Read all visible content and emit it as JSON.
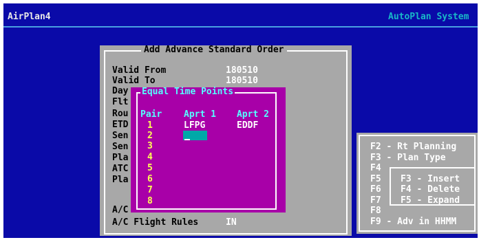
{
  "header": {
    "app_title": "AirPlan4",
    "system_title": "AutoPlan System"
  },
  "order": {
    "title": "Add Advance Standard Order",
    "fields": [
      {
        "label": "Valid From",
        "value": "180510"
      },
      {
        "label": "Valid To",
        "value": "180510"
      },
      {
        "label": "Day",
        "value": ""
      },
      {
        "label": "Flt",
        "value": ""
      },
      {
        "label": "Rou",
        "value": ""
      },
      {
        "label": "ETD",
        "value": ""
      },
      {
        "label": "Sen",
        "value": ""
      },
      {
        "label": "Sen",
        "value": ""
      },
      {
        "label": "Pla",
        "value": ""
      },
      {
        "label": "ATC",
        "value": ""
      },
      {
        "label": "Pla",
        "value": ""
      },
      {
        "label": "A/C",
        "value": ""
      },
      {
        "label": "A/C Flight Rules",
        "value": "IN"
      }
    ]
  },
  "equal_time_points": {
    "title": "Equal Time Points",
    "headers": [
      "Pair",
      "Aprt 1",
      "Aprt 2"
    ],
    "rows": [
      {
        "pair": "1",
        "aprt1": "LFPG",
        "aprt2": "EDDF"
      },
      {
        "pair": "2",
        "aprt1": "",
        "aprt2": ""
      },
      {
        "pair": "3",
        "aprt1": "",
        "aprt2": ""
      },
      {
        "pair": "4",
        "aprt1": "",
        "aprt2": ""
      },
      {
        "pair": "5",
        "aprt1": "",
        "aprt2": ""
      },
      {
        "pair": "6",
        "aprt1": "",
        "aprt2": ""
      },
      {
        "pair": "7",
        "aprt1": "",
        "aprt2": ""
      },
      {
        "pair": "8",
        "aprt1": "",
        "aprt2": ""
      }
    ]
  },
  "function_keys": {
    "outer": [
      "F2 - Rt Planning",
      "F3 - Plan Type",
      "F4",
      "F5",
      "F6",
      "F7",
      "F8",
      "F9 - Adv in HHMM"
    ],
    "inner": [
      "F3 - Insert",
      "F4 - Delete",
      "F5 - Expand"
    ]
  },
  "colors": {
    "background": "#0a0aa8",
    "panel": "#a8a8a8",
    "popup": "#a800a8",
    "accent": "#55ffff",
    "highlight": "#ffff55"
  }
}
